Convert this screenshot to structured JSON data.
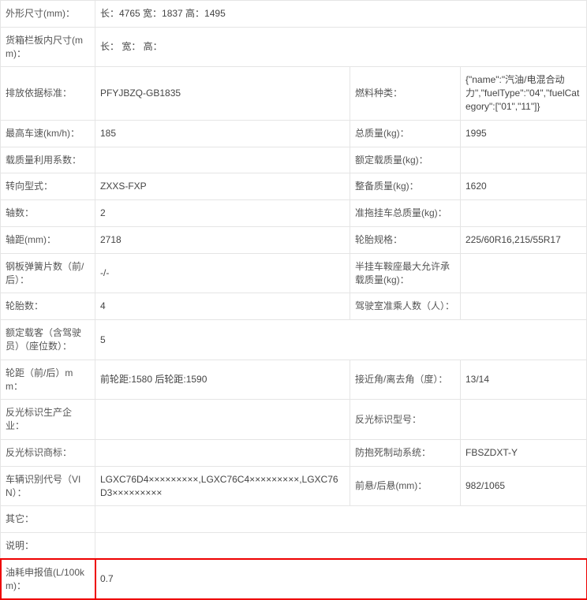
{
  "rows": [
    {
      "l1": "外形尺寸(mm)：",
      "v1": "长：4765 宽：1837 高：1495",
      "span": "full"
    },
    {
      "l1": "货箱栏板内尺寸(mm)：",
      "v1": "长： 宽： 高：",
      "span": "full"
    },
    {
      "l1": "排放依据标准：",
      "v1": "PFYJBZQ-GB1835",
      "l2": "燃料种类：",
      "v2": "{\"name\":\"汽油/电混合动力\",\"fuelType\":\"04\",\"fuelCategory\":[\"01\",\"11\"]}"
    },
    {
      "l1": "最高车速(km/h)：",
      "v1": "185",
      "l2": "总质量(kg)：",
      "v2": "1995"
    },
    {
      "l1": "载质量利用系数：",
      "v1": "",
      "l2": "额定载质量(kg)：",
      "v2": ""
    },
    {
      "l1": "转向型式：",
      "v1": "ZXXS-FXP",
      "l2": "整备质量(kg)：",
      "v2": "1620"
    },
    {
      "l1": "轴数：",
      "v1": "2",
      "l2": "准拖挂车总质量(kg)：",
      "v2": ""
    },
    {
      "l1": "轴距(mm)：",
      "v1": "2718",
      "l2": "轮胎规格：",
      "v2": "225/60R16,215/55R17"
    },
    {
      "l1": "钢板弹簧片数（前/后）：",
      "v1": "-/-",
      "l2": "半挂车鞍座最大允许承载质量(kg)：",
      "v2": ""
    },
    {
      "l1": "轮胎数：",
      "v1": "4",
      "l2": "驾驶室准乘人数（人）：",
      "v2": ""
    },
    {
      "l1": "额定载客（含驾驶员）（座位数）：",
      "v1": "5",
      "span": "full"
    },
    {
      "l1": "轮距（前/后）mm：",
      "v1": "前轮距:1580 后轮距:1590",
      "l2": "接近角/离去角（度）：",
      "v2": "13/14"
    },
    {
      "l1": "反光标识生产企业：",
      "v1": "",
      "l2": "反光标识型号：",
      "v2": ""
    },
    {
      "l1": "反光标识商标：",
      "v1": "",
      "l2": "防抱死制动系统：",
      "v2": "FBSZDXT-Y"
    },
    {
      "l1": "车辆识别代号（VIN）：",
      "v1": "LGXC76D4×××××××××,LGXC76C4×××××××××,LGXC76D3×××××××××",
      "l2": "前悬/后悬(mm)：",
      "v2": "982/1065"
    },
    {
      "l1": "其它：",
      "v1": "",
      "span": "full"
    },
    {
      "l1": "说明：",
      "v1": "",
      "span": "full"
    },
    {
      "l1": "油耗申报值(L/100km)：",
      "v1": "0.7",
      "span": "full",
      "highlight": true
    }
  ]
}
